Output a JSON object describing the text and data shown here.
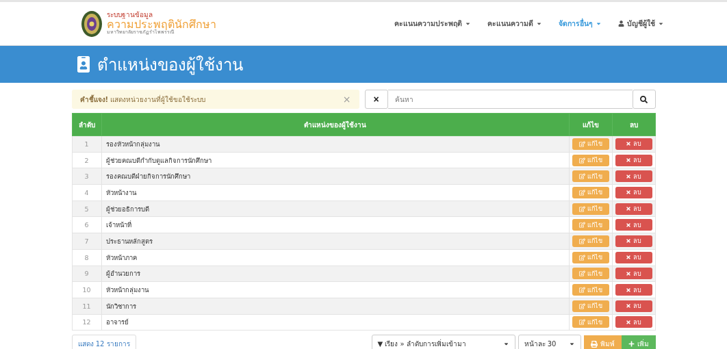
{
  "brand": {
    "line1": "ระบบฐานข้อมูล",
    "line2": "ความประพฤตินักศึกษา",
    "line3": "มหาวิทยาลัยราชภัฏรำไพพรรณี"
  },
  "nav": [
    {
      "label": "คะแนนความประพฤติ",
      "selected": false,
      "kind": "dropdown"
    },
    {
      "label": "คะแนนความดี",
      "selected": false,
      "kind": "dropdown"
    },
    {
      "label": "จัดการอื่นๆ",
      "selected": true,
      "kind": "dropdown"
    },
    {
      "label": "บัญชีผู้ใช้",
      "selected": false,
      "kind": "user"
    }
  ],
  "page_title": "ตำแหน่งของผู้ใช้งาน",
  "notice": {
    "text": "**คำชี้แจง!** แสดงหน่วยงานที่ผู้ใช้ขอใช้ระบบ",
    "close": "×"
  },
  "search": {
    "clear": "×",
    "placeholder": "ค้นหา"
  },
  "table": {
    "columns": [
      "ลำดับ",
      "ตำแหน่งของผู้ใช้งาน",
      "แก้ไข",
      "ลบ"
    ],
    "rows": [
      {
        "no": "1",
        "name": "รองหัวหน้ากลุ่มงาน",
        "edit": "แก้ไข",
        "delete": "ลบ"
      },
      {
        "no": "2",
        "name": "ผู้ช่วยคณบดีกำกับดูแลกิจการนักศึกษา",
        "edit": "แก้ไข",
        "delete": "ลบ"
      },
      {
        "no": "3",
        "name": "รองคณบดีฝ่ายกิจการนักศึกษา",
        "edit": "แก้ไข",
        "delete": "ลบ"
      },
      {
        "no": "4",
        "name": "หัวหน้างาน",
        "edit": "แก้ไข",
        "delete": "ลบ"
      },
      {
        "no": "5",
        "name": "ผู้ช่วยอธิการบดี",
        "edit": "แก้ไข",
        "delete": "ลบ"
      },
      {
        "no": "6",
        "name": "เจ้าหน้าที่",
        "edit": "แก้ไข",
        "delete": "ลบ"
      },
      {
        "no": "7",
        "name": "ประธานหลักสูตร",
        "edit": "แก้ไข",
        "delete": "ลบ"
      },
      {
        "no": "8",
        "name": "หัวหน้าภาค",
        "edit": "แก้ไข",
        "delete": "ลบ"
      },
      {
        "no": "9",
        "name": "ผู้อำนวยการ",
        "edit": "แก้ไข",
        "delete": "ลบ"
      },
      {
        "no": "10",
        "name": "หัวหน้ากลุ่มงาน",
        "edit": "แก้ไข",
        "delete": "ลบ"
      },
      {
        "no": "11",
        "name": "นักวิชาการ",
        "edit": "แก้ไข",
        "delete": "ลบ"
      },
      {
        "no": "12",
        "name": "อาจารย์",
        "edit": "แก้ไข",
        "delete": "ลบ"
      }
    ]
  },
  "footer": {
    "count": "แสดง 12 รายการ",
    "sort": "▼ เรียง » ลำดับการเพิ่มเข้ามา",
    "per_page": "หน้าละ 30",
    "print": "พิมพ์",
    "add": "เพิ่ม"
  }
}
